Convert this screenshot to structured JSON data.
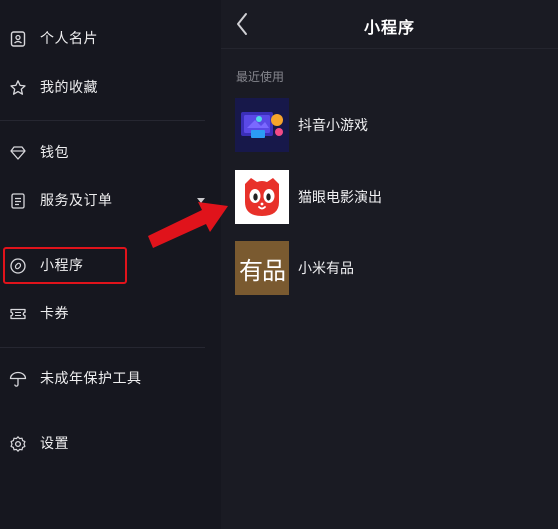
{
  "drawer": {
    "items": [
      {
        "label": "个人名片",
        "icon": "id-card-icon"
      },
      {
        "label": "我的收藏",
        "icon": "star-icon"
      },
      {
        "label": "钱包",
        "icon": "diamond-icon"
      },
      {
        "label": "服务及订单",
        "icon": "document-icon"
      },
      {
        "label": "小程序",
        "icon": "link-icon"
      },
      {
        "label": "卡券",
        "icon": "ticket-icon"
      },
      {
        "label": "未成年保护工具",
        "icon": "umbrella-icon"
      },
      {
        "label": "设置",
        "icon": "gear-icon"
      }
    ]
  },
  "panel": {
    "title": "小程序",
    "section_label": "最近使用",
    "apps": [
      {
        "name": "抖音小游戏",
        "icon": "douyin-game-icon"
      },
      {
        "name": "猫眼电影演出",
        "icon": "maoyan-cat-icon"
      },
      {
        "name": "小米有品",
        "icon": "xiaomi-youpin-icon",
        "icon_text": "有品"
      }
    ]
  },
  "colors": {
    "highlight": "#e0131b",
    "drawer_bg": "#16171f",
    "panel_bg": "#1a1b23",
    "maoyan_red": "#e8312a",
    "youpin_brown": "#7a5a30"
  }
}
